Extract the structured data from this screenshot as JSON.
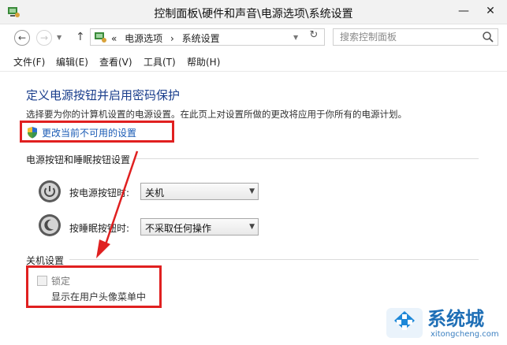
{
  "window": {
    "title": "控制面板\\硬件和声音\\电源选项\\系统设置",
    "minimize": "—",
    "close": "✕"
  },
  "address": {
    "back": "←",
    "forward": "→",
    "up": "↑",
    "chevrons": "«",
    "breadcrumbs": [
      "电源选项",
      "系统设置"
    ],
    "refresh": "↻",
    "search_placeholder": "搜索控制面板"
  },
  "menu": [
    "文件(F)",
    "编辑(E)",
    "查看(V)",
    "工具(T)",
    "帮助(H)"
  ],
  "page": {
    "title": "定义电源按钮并启用密码保护",
    "description": "选择要为你的计算机设置的电源设置。在此页上对设置所做的更改将应用于你所有的电源计划。",
    "change_link": "更改当前不可用的设置"
  },
  "power_section": {
    "heading": "电源按钮和睡眠按钮设置",
    "power_button_label": "按电源按钮时:",
    "power_button_value": "关机",
    "sleep_button_label": "按睡眠按钮时:",
    "sleep_button_value": "不采取任何操作"
  },
  "shutdown_section": {
    "heading": "关机设置",
    "lock_label": "锁定",
    "lock_checked": false,
    "lock_desc": "显示在用户头像菜单中"
  },
  "watermark": {
    "brand": "系统城",
    "url": "xitongcheng.com"
  },
  "colors": {
    "annotation": "#e02020",
    "link": "#1a5bb5",
    "title": "#1a3e8c"
  }
}
